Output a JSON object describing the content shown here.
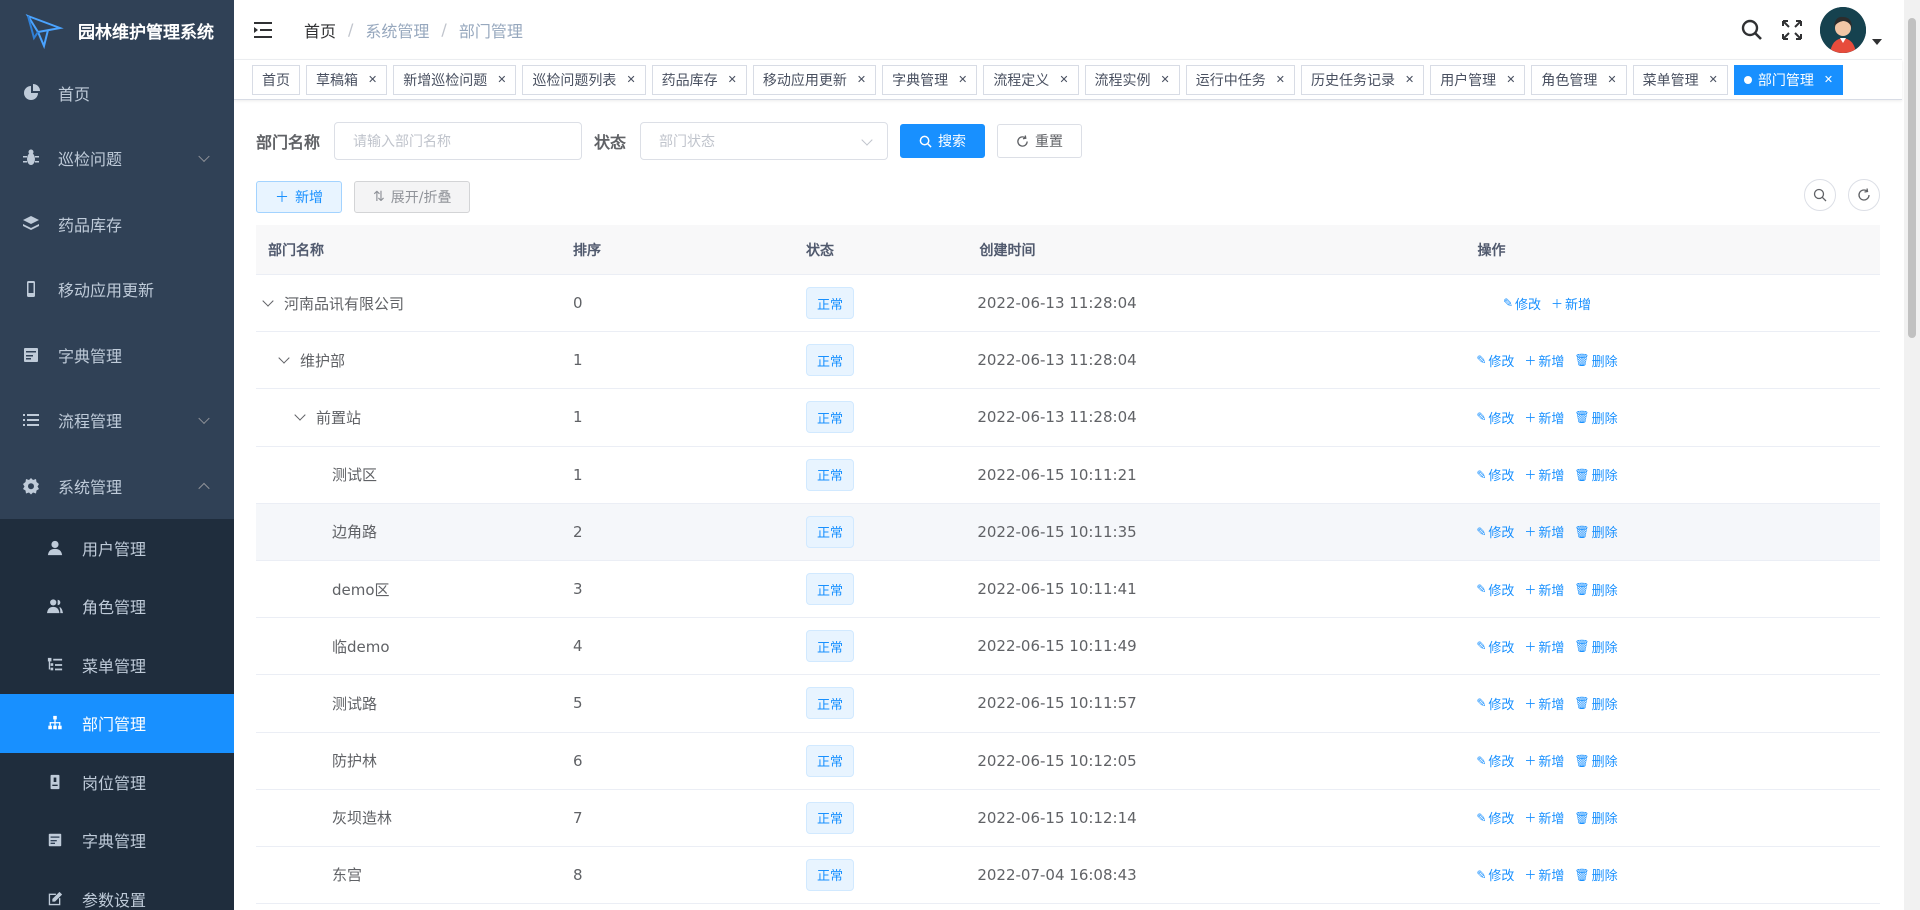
{
  "app": {
    "title": "园林维护管理系统"
  },
  "sidebar": {
    "items": [
      {
        "label": "首页",
        "icon": "dashboard-icon"
      },
      {
        "label": "巡检问题",
        "icon": "bug-icon",
        "arrow": "down"
      },
      {
        "label": "药品库存",
        "icon": "layers-icon"
      },
      {
        "label": "移动应用更新",
        "icon": "phone-icon"
      },
      {
        "label": "字典管理",
        "icon": "dict-icon"
      },
      {
        "label": "流程管理",
        "icon": "list-icon",
        "arrow": "down"
      },
      {
        "label": "系统管理",
        "icon": "gear-icon",
        "arrow": "up"
      }
    ],
    "sub_items": [
      {
        "label": "用户管理",
        "icon": "user-icon"
      },
      {
        "label": "角色管理",
        "icon": "peoples-icon"
      },
      {
        "label": "菜单管理",
        "icon": "tree-table-icon"
      },
      {
        "label": "部门管理",
        "icon": "tree-icon",
        "active": true
      },
      {
        "label": "岗位管理",
        "icon": "post-icon"
      },
      {
        "label": "字典管理",
        "icon": "dict-icon"
      },
      {
        "label": "参数设置",
        "icon": "edit-icon"
      }
    ]
  },
  "header": {
    "breadcrumb": [
      "首页",
      "系统管理",
      "部门管理"
    ]
  },
  "tags": [
    {
      "label": "首页",
      "closable": false
    },
    {
      "label": "草稿箱",
      "closable": true
    },
    {
      "label": "新增巡检问题",
      "closable": true
    },
    {
      "label": "巡检问题列表",
      "closable": true
    },
    {
      "label": "药品库存",
      "closable": true
    },
    {
      "label": "移动应用更新",
      "closable": true
    },
    {
      "label": "字典管理",
      "closable": true
    },
    {
      "label": "流程定义",
      "closable": true
    },
    {
      "label": "流程实例",
      "closable": true
    },
    {
      "label": "运行中任务",
      "closable": true
    },
    {
      "label": "历史任务记录",
      "closable": true
    },
    {
      "label": "用户管理",
      "closable": true
    },
    {
      "label": "角色管理",
      "closable": true
    },
    {
      "label": "菜单管理",
      "closable": true
    },
    {
      "label": "部门管理",
      "closable": true,
      "active": true
    }
  ],
  "search": {
    "dept_label": "部门名称",
    "dept_placeholder": "请输入部门名称",
    "status_label": "状态",
    "status_placeholder": "部门状态",
    "search_btn": "搜索",
    "reset_btn": "重置"
  },
  "toolbar": {
    "add_btn": "新增",
    "expand_btn": "展开/折叠"
  },
  "table": {
    "headers": [
      "部门名称",
      "排序",
      "状态",
      "创建时间",
      "操作"
    ],
    "op_edit": "修改",
    "op_add": "新增",
    "op_delete": "删除",
    "rows": [
      {
        "name": "河南品讯有限公司",
        "level": 0,
        "expand": true,
        "order": "0",
        "status": "正常",
        "time": "2022-06-13 11:28:04",
        "deletable": false
      },
      {
        "name": "维护部",
        "level": 1,
        "expand": true,
        "order": "1",
        "status": "正常",
        "time": "2022-06-13 11:28:04",
        "deletable": true
      },
      {
        "name": "前置站",
        "level": 2,
        "expand": true,
        "order": "1",
        "status": "正常",
        "time": "2022-06-13 11:28:04",
        "deletable": true
      },
      {
        "name": "测试区",
        "level": 3,
        "expand": false,
        "order": "1",
        "status": "正常",
        "time": "2022-06-15 10:11:21",
        "deletable": true
      },
      {
        "name": "边角路",
        "level": 3,
        "expand": false,
        "order": "2",
        "status": "正常",
        "time": "2022-06-15 10:11:35",
        "deletable": true,
        "hover": true
      },
      {
        "name": "demo区",
        "level": 3,
        "expand": false,
        "order": "3",
        "status": "正常",
        "time": "2022-06-15 10:11:41",
        "deletable": true
      },
      {
        "name": "临demo",
        "level": 3,
        "expand": false,
        "order": "4",
        "status": "正常",
        "time": "2022-06-15 10:11:49",
        "deletable": true
      },
      {
        "name": "测试路",
        "level": 3,
        "expand": false,
        "order": "5",
        "status": "正常",
        "time": "2022-06-15 10:11:57",
        "deletable": true
      },
      {
        "name": "防护林",
        "level": 3,
        "expand": false,
        "order": "6",
        "status": "正常",
        "time": "2022-06-15 10:12:05",
        "deletable": true
      },
      {
        "name": "灰坝造林",
        "level": 3,
        "expand": false,
        "order": "7",
        "status": "正常",
        "time": "2022-06-15 10:12:14",
        "deletable": true
      },
      {
        "name": "东宫",
        "level": 3,
        "expand": false,
        "order": "8",
        "status": "正常",
        "time": "2022-07-04 16:08:43",
        "deletable": true
      }
    ]
  },
  "colors": {
    "sidebar_bg": "#304156",
    "submenu_bg": "#1f2d3d",
    "accent": "#1890ff"
  }
}
